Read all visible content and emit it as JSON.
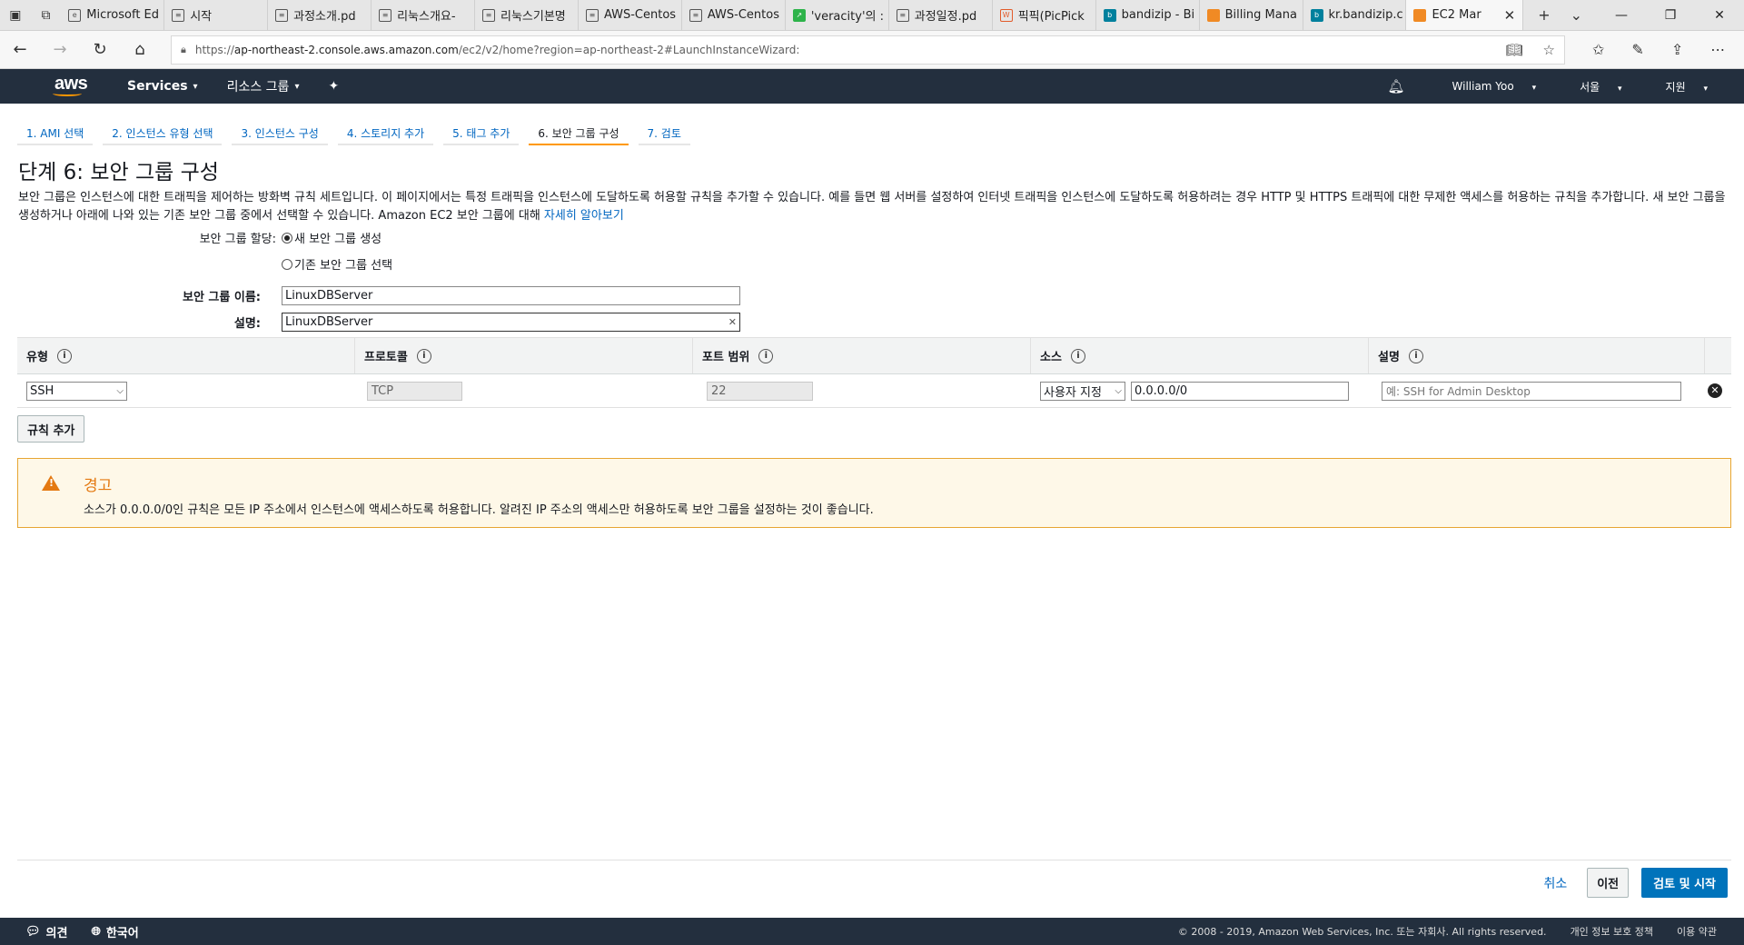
{
  "browser": {
    "tabs": [
      {
        "label": "Microsoft Ed",
        "icon": "edge-icon"
      },
      {
        "label": "시작",
        "icon": "page-icon"
      },
      {
        "label": "과정소개.pd",
        "icon": "page-icon"
      },
      {
        "label": "리눅스개요-",
        "icon": "page-icon"
      },
      {
        "label": "리눅스기본명",
        "icon": "page-icon"
      },
      {
        "label": "AWS-Centos",
        "icon": "page-icon"
      },
      {
        "label": "AWS-Centos",
        "icon": "page-icon"
      },
      {
        "label": "'veracity'의 :",
        "icon": "green-icon"
      },
      {
        "label": "과정일정.pd",
        "icon": "page-icon"
      },
      {
        "label": "픽픽(PicPick",
        "icon": "picpick-icon"
      },
      {
        "label": "bandizip - Bi",
        "icon": "bing-icon"
      },
      {
        "label": "Billing Mana",
        "icon": "aws-box-icon"
      },
      {
        "label": "kr.bandizip.c",
        "icon": "bing-icon"
      },
      {
        "label": "EC2 Mar",
        "icon": "aws-box-icon"
      }
    ],
    "url_prefix": "https://",
    "url_domain": "ap-northeast-2.console.aws.amazon.com",
    "url_path": "/ec2/v2/home?region=ap-northeast-2#LaunchInstanceWizard:"
  },
  "aws_nav": {
    "logo": "aws",
    "services": "Services",
    "resource_groups": "리소스 그룹",
    "user": "William Yoo",
    "region": "서울",
    "support": "지원"
  },
  "steps": [
    "1. AMI 선택",
    "2. 인스턴스 유형 선택",
    "3. 인스턴스 구성",
    "4. 스토리지 추가",
    "5. 태그 추가",
    "6. 보안 그룹 구성",
    "7. 검토"
  ],
  "page": {
    "title": "단계 6: 보안 그룹 구성",
    "description": "보안 그룹은 인스턴스에 대한 트래픽을 제어하는 방화벽 규칙 세트입니다. 이 페이지에서는 특정 트래픽을 인스턴스에 도달하도록 허용할 규칙을 추가할 수 있습니다. 예를 들면 웹 서버를 설정하여 인터넷 트래픽을 인스턴스에 도달하도록 허용하려는 경우 HTTP 및 HTTPS 트래픽에 대한 무제한 액세스를 허용하는 규칙을 추가합니다. 새 보안 그룹을 생성하거나 아래에 나와 있는 기존 보안 그룹 중에서 선택할 수 있습니다. Amazon EC2 보안 그룹에 대해 ",
    "learn_more": "자세히 알아보기"
  },
  "form": {
    "assign_label": "보안 그룹 할당:",
    "radio_new": "새 보안 그룹 생성",
    "radio_existing": "기존 보안 그룹 선택",
    "name_label": "보안 그룹 이름:",
    "name_value": "LinuxDBServer",
    "desc_label": "설명:",
    "desc_value": "LinuxDBServer"
  },
  "rules": {
    "headers": [
      "유형",
      "프로토콜",
      "포트 범위",
      "소스",
      "설명"
    ],
    "row": {
      "type": "SSH",
      "protocol": "TCP",
      "port": "22",
      "source_mode": "사용자 지정",
      "source_cidr": "0.0.0.0/0",
      "desc_placeholder": "예: SSH for Admin Desktop"
    },
    "add_rule": "규칙 추가"
  },
  "warning": {
    "title": "경고",
    "message": "소스가 0.0.0.0/0인 규칙은 모든 IP 주소에서 인스턴스에 액세스하도록 허용합니다. 알려진 IP 주소의 액세스만 허용하도록 보안 그룹을 설정하는 것이 좋습니다."
  },
  "actions": {
    "cancel": "취소",
    "previous": "이전",
    "review_launch": "검토 및 시작"
  },
  "footer": {
    "feedback": "의견",
    "language": "한국어",
    "copyright": "© 2008 - 2019, Amazon Web Services, Inc. 또는 자회사. All rights reserved.",
    "privacy": "개인 정보 보호 정책",
    "terms": "이용 약관"
  },
  "colors": {
    "aws_nav": "#232f3e",
    "accent_orange": "#ff9900",
    "primary_blue": "#0073bb",
    "warning_orange": "#e47911"
  }
}
